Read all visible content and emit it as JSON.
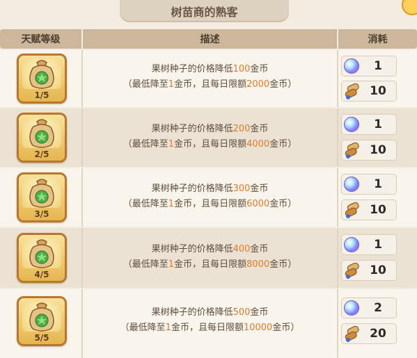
{
  "title": "树苗商的熟客",
  "headers": {
    "talent": "天赋等级",
    "desc": "描述",
    "cost": "消耗"
  },
  "icons": {
    "talent": "seed-bag-icon",
    "cost_a": "crystal-orb-icon",
    "cost_b": "scroll-icon"
  },
  "rows": [
    {
      "level": "1/5",
      "line1": {
        "pre": "果树种子的价格降低",
        "num": "100",
        "post": "金币"
      },
      "line2": {
        "pre": "（最低降至",
        "num1": "1",
        "mid": "金币，且每日限额",
        "num2": "2000",
        "post": "金币）"
      },
      "cost_a": "1",
      "cost_b": "10"
    },
    {
      "level": "2/5",
      "line1": {
        "pre": "果树种子的价格降低",
        "num": "200",
        "post": "金币"
      },
      "line2": {
        "pre": "（最低降至",
        "num1": "1",
        "mid": "金币，且每日限额",
        "num2": "4000",
        "post": "金币）"
      },
      "cost_a": "1",
      "cost_b": "10"
    },
    {
      "level": "3/5",
      "line1": {
        "pre": "果树种子的价格降低",
        "num": "300",
        "post": "金币"
      },
      "line2": {
        "pre": "（最低降至",
        "num1": "1",
        "mid": "金币，且每日限额",
        "num2": "6000",
        "post": "金币）"
      },
      "cost_a": "1",
      "cost_b": "10"
    },
    {
      "level": "4/5",
      "line1": {
        "pre": "果树种子的价格降低",
        "num": "400",
        "post": "金币"
      },
      "line2": {
        "pre": "（最低降至",
        "num1": "1",
        "mid": "金币，且每日限额",
        "num2": "8000",
        "post": "金币）"
      },
      "cost_a": "1",
      "cost_b": "10"
    },
    {
      "level": "5/5",
      "line1": {
        "pre": "果树种子的价格降低",
        "num": "500",
        "post": "金币"
      },
      "line2": {
        "pre": "（最低降至",
        "num1": "1",
        "mid": "金币，且每日限额",
        "num2": "10000",
        "post": "金币）"
      },
      "cost_a": "2",
      "cost_b": "20"
    }
  ]
}
